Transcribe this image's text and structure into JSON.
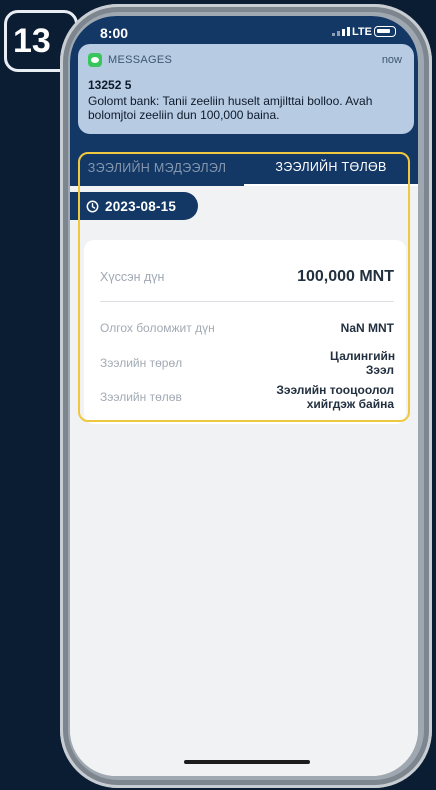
{
  "step": {
    "number": "13"
  },
  "status_bar": {
    "time": "8:00",
    "network": "LTE"
  },
  "notification": {
    "app": "MESSAGES",
    "time": "now",
    "sender": "13252 5",
    "body": "Golomt bank: Tanii zeeliin huselt amjilttai bolloo. Avah bolomjtoi zeeliin dun 100,000 baina."
  },
  "tabs": [
    {
      "label": "ЗЭЭЛИЙН МЭДЭЭЛЭЛ",
      "active": false
    },
    {
      "label": "ЗЭЭЛИЙН ТӨЛӨВ",
      "active": true
    }
  ],
  "date": "2023-08-15",
  "card": {
    "requested_label": "Хүссэн дүн",
    "requested_value": "100,000 MNT",
    "rows": [
      {
        "label": "Олгох боломжит дүн",
        "value": "NaN MNT"
      },
      {
        "label": "Зээлийн төрөл",
        "value": "Цалингийн Зээл"
      },
      {
        "label": "Зээлийн төлөв",
        "value": "Зээлийн тооцоолол хийгдэж байна"
      }
    ]
  },
  "colors": {
    "brand": "#133866",
    "highlight": "#f0c83f",
    "notification_bg": "#b7cbe3",
    "messages_green": "#38c55b"
  },
  "icons": [
    "messages-icon",
    "clock-icon",
    "battery-icon",
    "signal-icon"
  ]
}
